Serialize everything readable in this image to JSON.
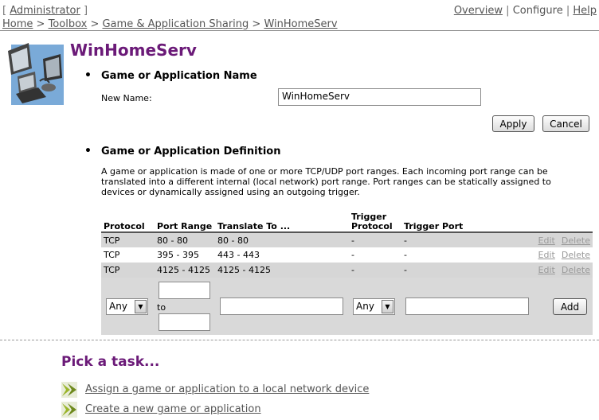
{
  "header": {
    "admin_label": "Administrator",
    "links": [
      "Overview",
      "Configure",
      "Help"
    ]
  },
  "breadcrumb": [
    "Home",
    "Toolbox",
    "Game & Application Sharing",
    "WinHomeServ"
  ],
  "page_title": "WinHomeServ",
  "name_section": {
    "heading": "Game or Application Name",
    "new_name_label": "New Name:",
    "new_name_value": "WinHomeServ",
    "apply_label": "Apply",
    "cancel_label": "Cancel"
  },
  "definition_section": {
    "heading": "Game or Application Definition",
    "description": "A game or application is made of one or more TCP/UDP port ranges. Each incoming port range can be translated into a different internal (local network) port range. Port ranges can be statically assigned to devices or dynamically assigned using an outgoing trigger."
  },
  "port_table": {
    "columns": [
      "Protocol",
      "Port Range",
      "Translate To ...",
      "Trigger Protocol",
      "Trigger Port"
    ],
    "rows": [
      {
        "protocol": "TCP",
        "port_range": "80 - 80",
        "translate_to": "80 - 80",
        "trigger_protocol": "-",
        "trigger_port": "-",
        "edit": "Edit",
        "delete": "Delete"
      },
      {
        "protocol": "TCP",
        "port_range": "395 - 395",
        "translate_to": "443 - 443",
        "trigger_protocol": "-",
        "trigger_port": "-",
        "edit": "Edit",
        "delete": "Delete"
      },
      {
        "protocol": "TCP",
        "port_range": "4125 - 4125",
        "translate_to": "4125 - 4125",
        "trigger_protocol": "-",
        "trigger_port": "-",
        "edit": "Edit",
        "delete": "Delete"
      }
    ]
  },
  "add_row": {
    "protocol_selected": "Any",
    "to_label": "to",
    "trigger_protocol_selected": "Any",
    "add_label": "Add"
  },
  "tasks": {
    "heading": "Pick a task...",
    "items": [
      "Assign a game or application to a local network device",
      "Create a new game or application"
    ]
  },
  "colors": {
    "title": "#6b1a78",
    "task_arrow": "#9ab52a",
    "row_shade": "#d6d6d6"
  }
}
